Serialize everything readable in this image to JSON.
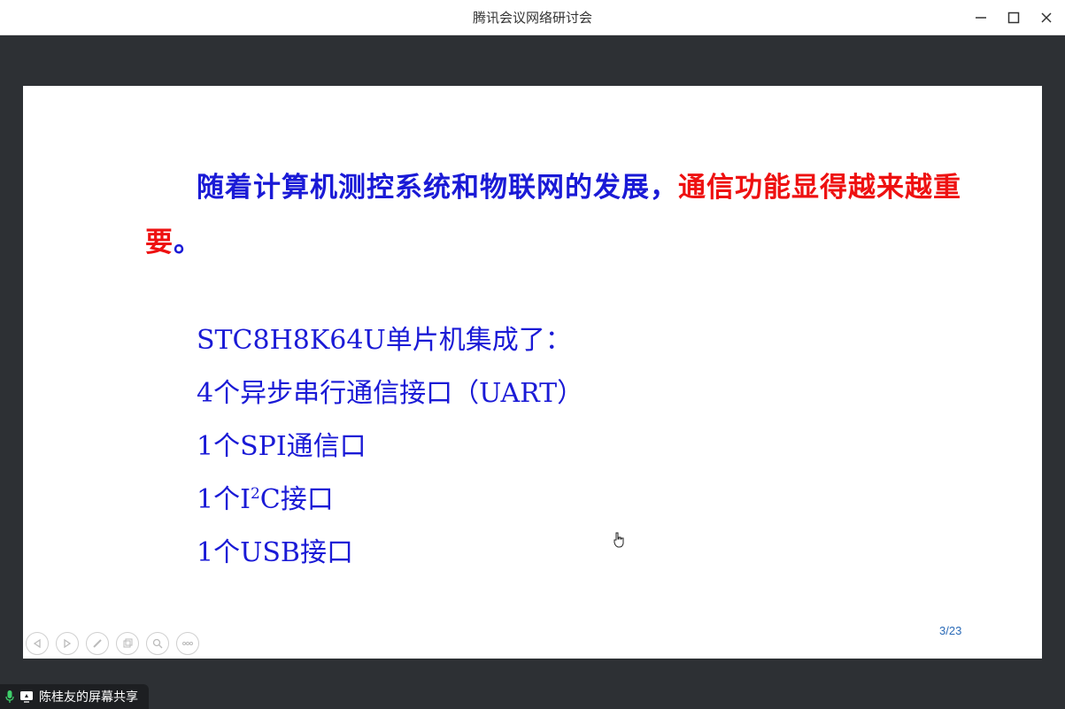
{
  "window": {
    "title": "腾讯会议网络研讨会"
  },
  "slide": {
    "paragraph_blue": "随着计算机测控系统和物联网的发展，",
    "paragraph_red": "通信功能显得越来越重要",
    "paragraph_end": "。",
    "lines": [
      "STC8H8K64U单片机集成了：",
      "4个异步串行通信接口（UART）",
      "1个SPI通信口",
      "1个I",
      "1个USB接口"
    ],
    "i2c_superscript": "2",
    "i2c_suffix": "C接口",
    "page_indicator": "3/23"
  },
  "sharing": {
    "label": "陈桂友的屏幕共享"
  }
}
